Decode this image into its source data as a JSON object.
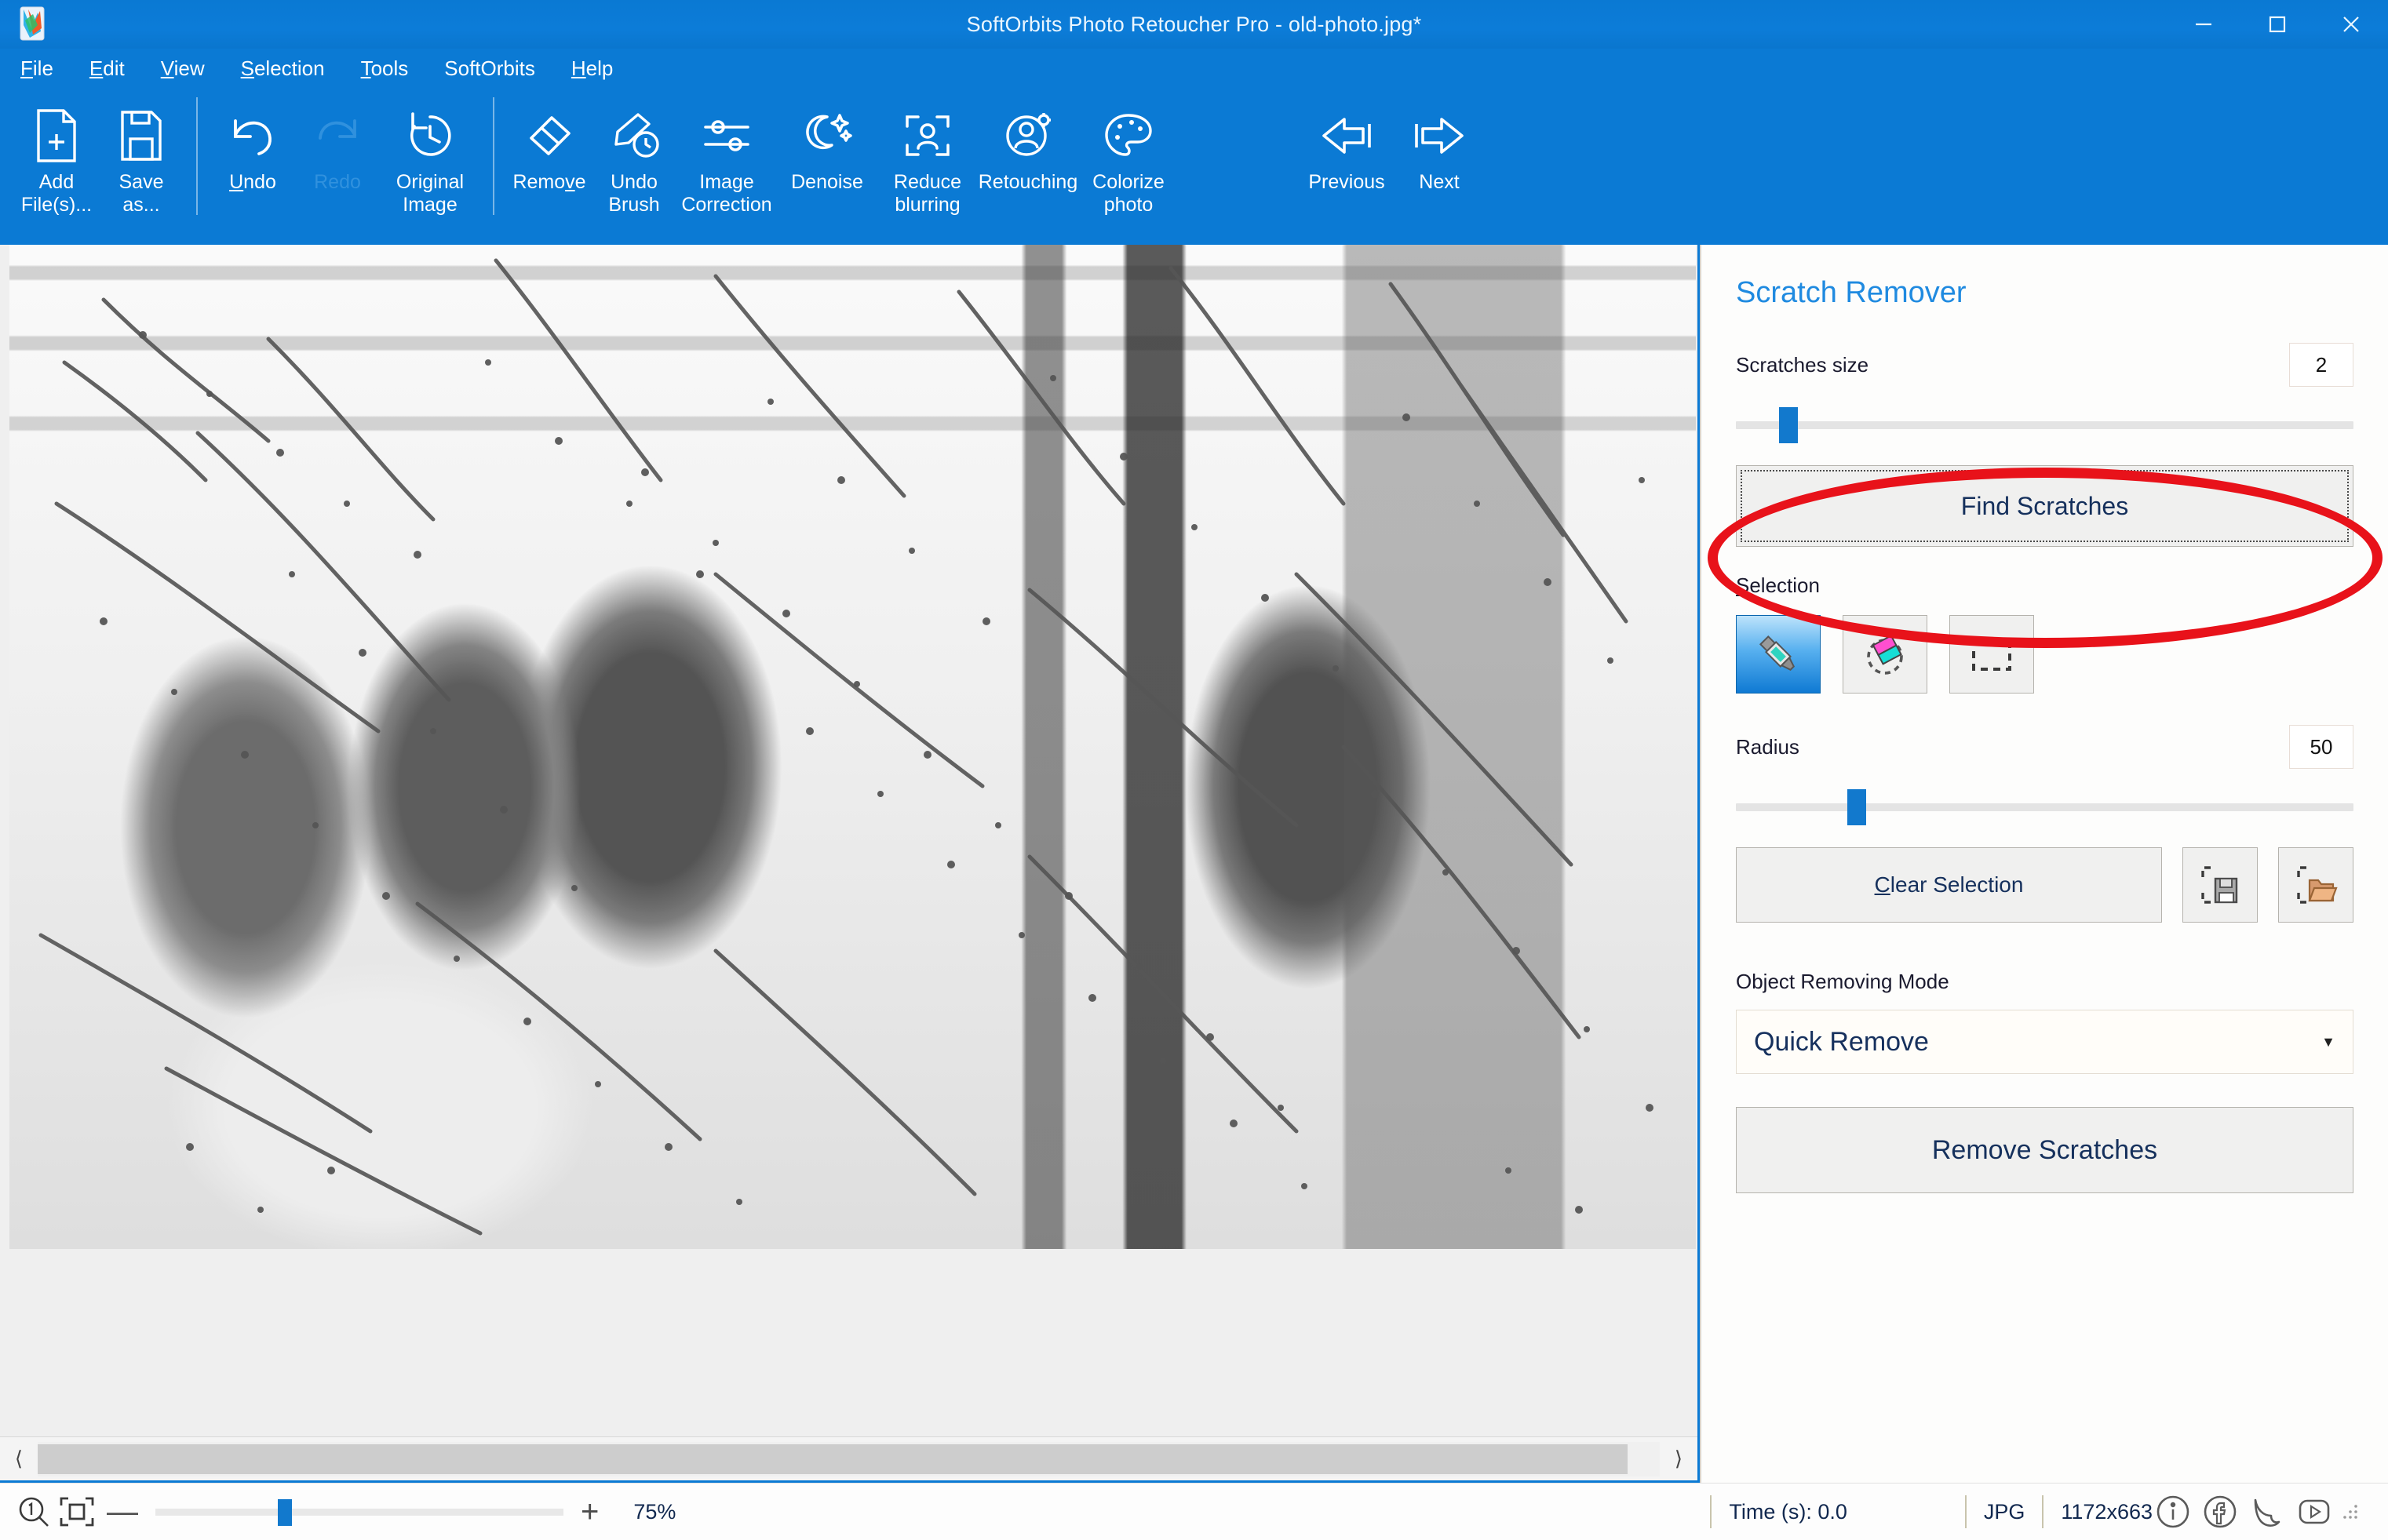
{
  "window": {
    "title": "SoftOrbits Photo Retoucher Pro - old-photo.jpg*",
    "logo_icon": "app-logo-icon",
    "minimize_icon": "minimize-icon",
    "maximize_icon": "maximize-icon",
    "close_icon": "close-icon",
    "accent_color": "#0b7ad4"
  },
  "menu": {
    "items": [
      {
        "label": "File",
        "mnemonic": "F"
      },
      {
        "label": "Edit",
        "mnemonic": "E"
      },
      {
        "label": "View",
        "mnemonic": "V"
      },
      {
        "label": "Selection",
        "mnemonic": "S"
      },
      {
        "label": "Tools",
        "mnemonic": "T"
      },
      {
        "label": "SoftOrbits",
        "mnemonic": ""
      },
      {
        "label": "Help",
        "mnemonic": "H"
      }
    ]
  },
  "toolbar": {
    "items": [
      {
        "label_line1": "Add",
        "label_line2": "File(s)...",
        "icon": "add-file-icon",
        "enabled": true
      },
      {
        "label_line1": "Save",
        "label_line2": "as...",
        "icon": "save-as-icon",
        "enabled": true
      },
      {
        "label_line1": "Undo",
        "label_line2": "",
        "icon": "undo-icon",
        "enabled": true
      },
      {
        "label_line1": "Redo",
        "label_line2": "",
        "icon": "redo-icon",
        "enabled": false
      },
      {
        "label_line1": "Original",
        "label_line2": "Image",
        "icon": "original-image-icon",
        "enabled": true
      },
      {
        "label_line1": "Remove",
        "label_line2": "",
        "icon": "eraser-icon",
        "enabled": true
      },
      {
        "label_line1": "Undo",
        "label_line2": "Brush",
        "icon": "undo-brush-icon",
        "enabled": true
      },
      {
        "label_line1": "Image",
        "label_line2": "Correction",
        "icon": "sliders-icon",
        "enabled": true
      },
      {
        "label_line1": "Denoise",
        "label_line2": "",
        "icon": "moon-sparkle-icon",
        "enabled": true
      },
      {
        "label_line1": "Reduce",
        "label_line2": "blurring",
        "icon": "focus-person-icon",
        "enabled": true
      },
      {
        "label_line1": "Retouching",
        "label_line2": "",
        "icon": "person-gear-icon",
        "enabled": true
      },
      {
        "label_line1": "Colorize",
        "label_line2": "photo",
        "icon": "palette-icon",
        "enabled": true
      },
      {
        "label_line1": "Previous",
        "label_line2": "",
        "icon": "arrow-left-icon",
        "enabled": true
      },
      {
        "label_line1": "Next",
        "label_line2": "",
        "icon": "arrow-right-icon",
        "enabled": true
      }
    ]
  },
  "canvas": {
    "image_alt": "Vintage black and white photograph of a boy and three men on a porch, overlaid with red detected scratches",
    "scroll_left_icon": "chevron-left-icon",
    "scroll_right_icon": "chevron-right-icon",
    "scratch_overlay_color": "#ff2a2a"
  },
  "panel": {
    "title": "Scratch Remover",
    "scratches_size": {
      "label": "Scratches size",
      "value": "2",
      "slider_percent": 7
    },
    "find_scratches_button": "Find Scratches",
    "selection": {
      "label": "Selection",
      "mnemonic": "S",
      "tools": [
        {
          "name": "marker-tool",
          "icon": "marker-icon",
          "active": true
        },
        {
          "name": "eraser-tool",
          "icon": "selection-eraser-icon",
          "active": false
        },
        {
          "name": "rectangle-select-tool",
          "icon": "rectangle-select-icon",
          "active": false
        }
      ]
    },
    "radius": {
      "label": "Radius",
      "value": "50",
      "slider_percent": 18
    },
    "clear_selection_button": "Clear Selection",
    "save_selection_icon": "save-selection-icon",
    "open_selection_icon": "open-selection-icon",
    "object_removing_mode": {
      "label": "Object Removing Mode",
      "value": "Quick Remove",
      "caret_icon": "chevron-down-icon"
    },
    "remove_scratches_button": "Remove Scratches"
  },
  "annotation": {
    "shape": "ellipse",
    "color": "#e8121a",
    "target": "Find Scratches"
  },
  "statusbar": {
    "zoom_actual_icon": "zoom-actual-size-icon",
    "zoom_fit_icon": "zoom-fit-icon",
    "minus_label": "—",
    "plus_label": "+",
    "zoom_percent": "75%",
    "zoom_slider_percent": 30,
    "time_label": "Time (s): 0.0",
    "format_label": "JPG",
    "dimensions_label": "1172x663",
    "social": [
      {
        "name": "info-icon",
        "glyph": "i"
      },
      {
        "name": "facebook-icon",
        "glyph": "f"
      },
      {
        "name": "twitter-icon",
        "glyph": "t"
      },
      {
        "name": "youtube-icon",
        "glyph": "y"
      }
    ],
    "grip_icon": "resize-grip-icon"
  }
}
